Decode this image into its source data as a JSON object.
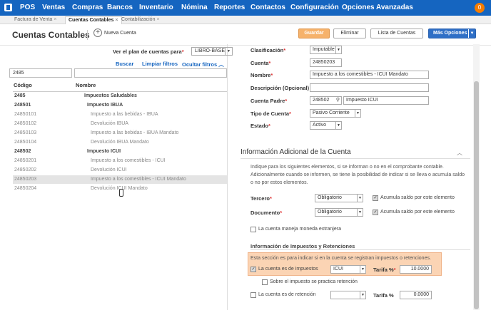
{
  "nav": {
    "items": [
      "POS",
      "Ventas",
      "Compras",
      "Bancos",
      "Inventario",
      "Nómina",
      "Reportes",
      "Contactos",
      "Configuración",
      "Opciones Avanzadas"
    ],
    "notifications": "0"
  },
  "tabs": [
    {
      "label": "Factura de Venta"
    },
    {
      "label": "Cuentas Contables"
    },
    {
      "label": "Contabilización"
    }
  ],
  "header": {
    "title": "Cuentas Contables",
    "new_label": "Nueva Cuenta",
    "save": "Guardar",
    "delete": "Eliminar",
    "list": "Lista de Cuentas",
    "more": "Más Opciones"
  },
  "left": {
    "plan_label": "Ver el plan de cuentas para",
    "plan_value": "LIBRO-BASE",
    "search": "Buscar",
    "clear": "Limpiar filtros",
    "hide": "Ocultar filtros",
    "filter_code": "2485",
    "col_code": "Código",
    "col_name": "Nombre",
    "rows": [
      {
        "code": "2485",
        "name": "Impuestos Saludables"
      },
      {
        "code": "248501",
        "name": "Impuesto IBUA"
      },
      {
        "code": "24850101",
        "name": "Impuesto a las bebidas - IBUA"
      },
      {
        "code": "24850102",
        "name": "Devolución IBUA"
      },
      {
        "code": "24850103",
        "name": "Impuesto a las bebidas - IBUA Mandato"
      },
      {
        "code": "24850104",
        "name": "Devolución IBUA Mandato"
      },
      {
        "code": "248502",
        "name": "Impuesto ICUI"
      },
      {
        "code": "24850201",
        "name": "Impuesto a los comestibles - ICUI"
      },
      {
        "code": "24850202",
        "name": "Devolución ICUI"
      },
      {
        "code": "24850203",
        "name": "Impuesto a los comestibles - ICUI Mandato"
      },
      {
        "code": "24850204",
        "name": "Devolución ICUI Mandato"
      }
    ]
  },
  "form": {
    "clasificacion_label": "Clasificación",
    "clasificacion": "Imputable",
    "cuenta_label": "Cuenta",
    "cuenta": "24850203",
    "nombre_label": "Nombre",
    "nombre": "Impuesto a los comestibles - ICUI Mandato",
    "descripcion_label": "Descripción (Opcional)",
    "descripcion": "",
    "padre_label": "Cuenta Padre",
    "padre_code": "248502",
    "padre_name": "Impuesto ICUI",
    "tipo_label": "Tipo de Cuenta",
    "tipo": "Pasivo Corriente",
    "estado_label": "Estado",
    "estado": "Activo"
  },
  "additional": {
    "title": "Información Adicional de la Cuenta",
    "text": "Indique para los siguientes elementos, si se informan o no en el comprobante contable. Adicionalmente cuando se informen, se tiene la posibilidad de indicar si se lleva o acumula saldo o no por estos elementos.",
    "tercero_label": "Tercero",
    "tercero": "Obligatorio",
    "documento_label": "Documento",
    "documento": "Obligatorio",
    "acumula": "Acumula saldo por este elemento",
    "moneda": "La cuenta maneja moneda extranjera"
  },
  "taxes": {
    "title": "Información de Impuestos y Retenciones",
    "hint": "Esta sección es para indicar si en la cuenta se registran impuestos o retenciones.",
    "is_tax": "La cuenta es de impuestos",
    "tax_type": "ICUI",
    "tarifa_label": "Tarifa %",
    "tarifa": "10.0000",
    "retencion_sobre": "Sobre el impuesto se practica retención",
    "is_retencion": "La cuenta es de retención",
    "tarifa2_label": "Tarifa %",
    "tarifa2": "0.0000"
  },
  "colors": {
    "nav": "#1565c0",
    "save": "#f6b26b",
    "highlight": "#fbd4b4",
    "badge": "#f57c00"
  }
}
